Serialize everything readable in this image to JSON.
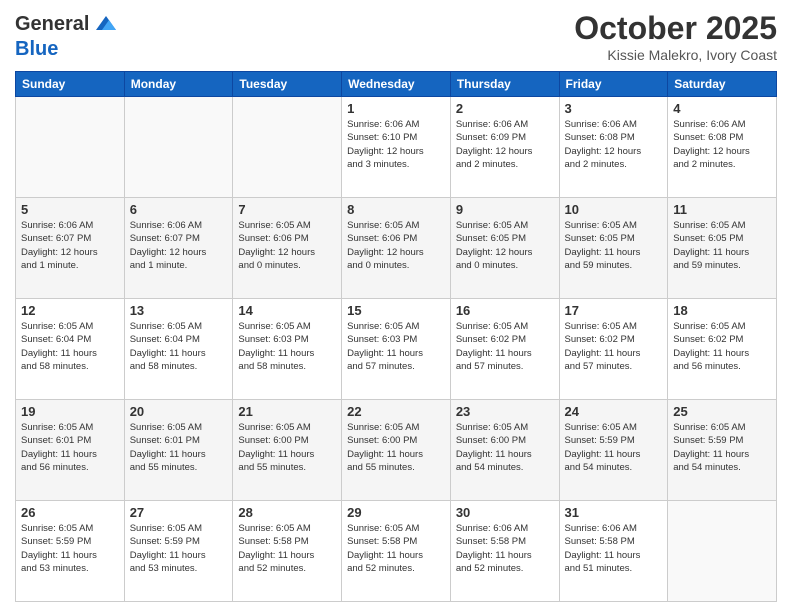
{
  "header": {
    "logo_line1": "General",
    "logo_line2": "Blue",
    "month_title": "October 2025",
    "location": "Kissie Malekro, Ivory Coast"
  },
  "days_of_week": [
    "Sunday",
    "Monday",
    "Tuesday",
    "Wednesday",
    "Thursday",
    "Friday",
    "Saturday"
  ],
  "weeks": [
    [
      {
        "day": "",
        "info": ""
      },
      {
        "day": "",
        "info": ""
      },
      {
        "day": "",
        "info": ""
      },
      {
        "day": "1",
        "info": "Sunrise: 6:06 AM\nSunset: 6:10 PM\nDaylight: 12 hours\nand 3 minutes."
      },
      {
        "day": "2",
        "info": "Sunrise: 6:06 AM\nSunset: 6:09 PM\nDaylight: 12 hours\nand 2 minutes."
      },
      {
        "day": "3",
        "info": "Sunrise: 6:06 AM\nSunset: 6:08 PM\nDaylight: 12 hours\nand 2 minutes."
      },
      {
        "day": "4",
        "info": "Sunrise: 6:06 AM\nSunset: 6:08 PM\nDaylight: 12 hours\nand 2 minutes."
      }
    ],
    [
      {
        "day": "5",
        "info": "Sunrise: 6:06 AM\nSunset: 6:07 PM\nDaylight: 12 hours\nand 1 minute."
      },
      {
        "day": "6",
        "info": "Sunrise: 6:06 AM\nSunset: 6:07 PM\nDaylight: 12 hours\nand 1 minute."
      },
      {
        "day": "7",
        "info": "Sunrise: 6:05 AM\nSunset: 6:06 PM\nDaylight: 12 hours\nand 0 minutes."
      },
      {
        "day": "8",
        "info": "Sunrise: 6:05 AM\nSunset: 6:06 PM\nDaylight: 12 hours\nand 0 minutes."
      },
      {
        "day": "9",
        "info": "Sunrise: 6:05 AM\nSunset: 6:05 PM\nDaylight: 12 hours\nand 0 minutes."
      },
      {
        "day": "10",
        "info": "Sunrise: 6:05 AM\nSunset: 6:05 PM\nDaylight: 11 hours\nand 59 minutes."
      },
      {
        "day": "11",
        "info": "Sunrise: 6:05 AM\nSunset: 6:05 PM\nDaylight: 11 hours\nand 59 minutes."
      }
    ],
    [
      {
        "day": "12",
        "info": "Sunrise: 6:05 AM\nSunset: 6:04 PM\nDaylight: 11 hours\nand 58 minutes."
      },
      {
        "day": "13",
        "info": "Sunrise: 6:05 AM\nSunset: 6:04 PM\nDaylight: 11 hours\nand 58 minutes."
      },
      {
        "day": "14",
        "info": "Sunrise: 6:05 AM\nSunset: 6:03 PM\nDaylight: 11 hours\nand 58 minutes."
      },
      {
        "day": "15",
        "info": "Sunrise: 6:05 AM\nSunset: 6:03 PM\nDaylight: 11 hours\nand 57 minutes."
      },
      {
        "day": "16",
        "info": "Sunrise: 6:05 AM\nSunset: 6:02 PM\nDaylight: 11 hours\nand 57 minutes."
      },
      {
        "day": "17",
        "info": "Sunrise: 6:05 AM\nSunset: 6:02 PM\nDaylight: 11 hours\nand 57 minutes."
      },
      {
        "day": "18",
        "info": "Sunrise: 6:05 AM\nSunset: 6:02 PM\nDaylight: 11 hours\nand 56 minutes."
      }
    ],
    [
      {
        "day": "19",
        "info": "Sunrise: 6:05 AM\nSunset: 6:01 PM\nDaylight: 11 hours\nand 56 minutes."
      },
      {
        "day": "20",
        "info": "Sunrise: 6:05 AM\nSunset: 6:01 PM\nDaylight: 11 hours\nand 55 minutes."
      },
      {
        "day": "21",
        "info": "Sunrise: 6:05 AM\nSunset: 6:00 PM\nDaylight: 11 hours\nand 55 minutes."
      },
      {
        "day": "22",
        "info": "Sunrise: 6:05 AM\nSunset: 6:00 PM\nDaylight: 11 hours\nand 55 minutes."
      },
      {
        "day": "23",
        "info": "Sunrise: 6:05 AM\nSunset: 6:00 PM\nDaylight: 11 hours\nand 54 minutes."
      },
      {
        "day": "24",
        "info": "Sunrise: 6:05 AM\nSunset: 5:59 PM\nDaylight: 11 hours\nand 54 minutes."
      },
      {
        "day": "25",
        "info": "Sunrise: 6:05 AM\nSunset: 5:59 PM\nDaylight: 11 hours\nand 54 minutes."
      }
    ],
    [
      {
        "day": "26",
        "info": "Sunrise: 6:05 AM\nSunset: 5:59 PM\nDaylight: 11 hours\nand 53 minutes."
      },
      {
        "day": "27",
        "info": "Sunrise: 6:05 AM\nSunset: 5:59 PM\nDaylight: 11 hours\nand 53 minutes."
      },
      {
        "day": "28",
        "info": "Sunrise: 6:05 AM\nSunset: 5:58 PM\nDaylight: 11 hours\nand 52 minutes."
      },
      {
        "day": "29",
        "info": "Sunrise: 6:05 AM\nSunset: 5:58 PM\nDaylight: 11 hours\nand 52 minutes."
      },
      {
        "day": "30",
        "info": "Sunrise: 6:06 AM\nSunset: 5:58 PM\nDaylight: 11 hours\nand 52 minutes."
      },
      {
        "day": "31",
        "info": "Sunrise: 6:06 AM\nSunset: 5:58 PM\nDaylight: 11 hours\nand 51 minutes."
      },
      {
        "day": "",
        "info": ""
      }
    ]
  ]
}
